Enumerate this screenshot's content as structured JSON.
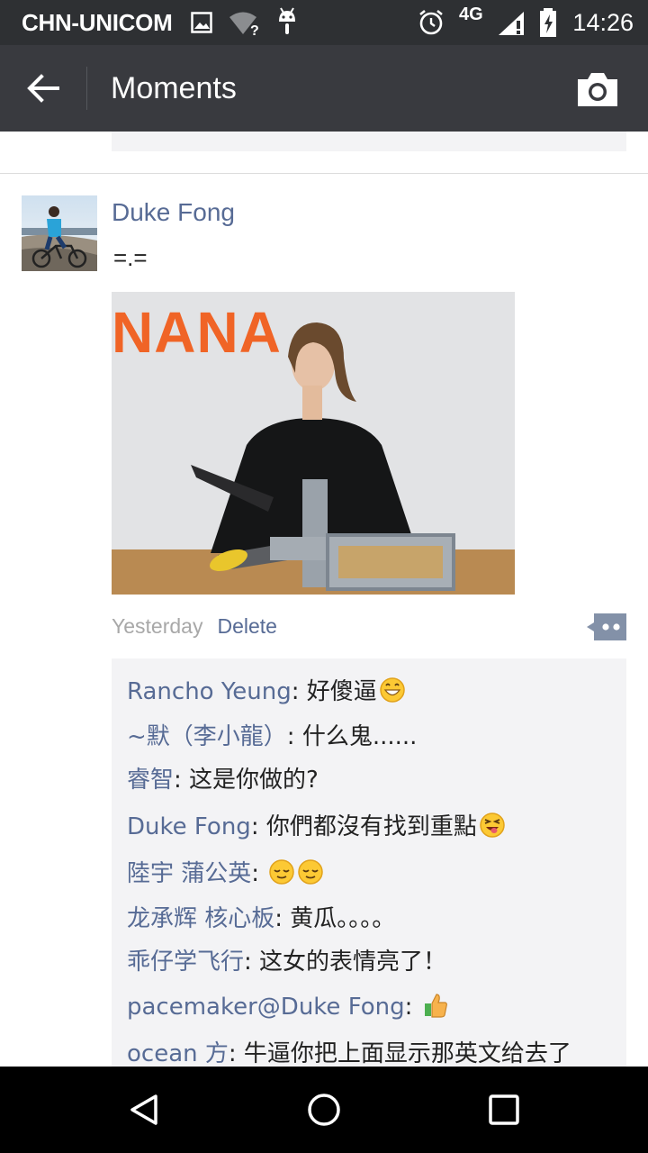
{
  "status_bar": {
    "carrier": "CHN-UNICOM",
    "network": "4G",
    "time": "14:26",
    "icons": [
      "image-icon",
      "wifi-unknown-icon",
      "android-icon",
      "alarm-icon",
      "signal-icon",
      "battery-charging-icon"
    ]
  },
  "toolbar": {
    "title": "Moments",
    "back_icon": "arrow-left-icon",
    "camera_icon": "camera-icon"
  },
  "post": {
    "author": "Duke Fong",
    "text": "=.=",
    "photo_overlay_text": "NANA",
    "time": "Yesterday",
    "delete_label": "Delete",
    "comments": [
      {
        "who": "Rancho Yeung",
        "text": ": 好傻逼",
        "emoji": [
          "grin-emoji"
        ]
      },
      {
        "who": "~默（李小龍）",
        "text": ": 什么鬼......",
        "emoji": []
      },
      {
        "who": "睿智",
        "text": ": 这是你做的?",
        "emoji": []
      },
      {
        "who": "Duke Fong",
        "text": ": 你們都沒有找到重點",
        "emoji": [
          "squint-tongue-emoji"
        ]
      },
      {
        "who": "陸宇 蒲公英",
        "text": ": ",
        "emoji": [
          "relieved-emoji",
          "relieved-emoji"
        ]
      },
      {
        "who": "龙承辉 核心板",
        "text": ": 黄瓜。。。。",
        "emoji": []
      },
      {
        "who": "乖仔学飞行",
        "text": ": 这女的表情亮了！",
        "emoji": []
      },
      {
        "who": "pacemaker@Duke Fong",
        "text": ": ",
        "emoji": [
          "thumbs-up-emoji"
        ]
      },
      {
        "who": "ocean 方",
        "text": ": 牛逼你把上面显示那英文给去了",
        "emoji": []
      }
    ]
  },
  "colors": {
    "status_bar_bg": "#2e3033",
    "toolbar_bg": "#393a3f",
    "link": "#576b95",
    "comment_bg": "#f3f3f5"
  }
}
